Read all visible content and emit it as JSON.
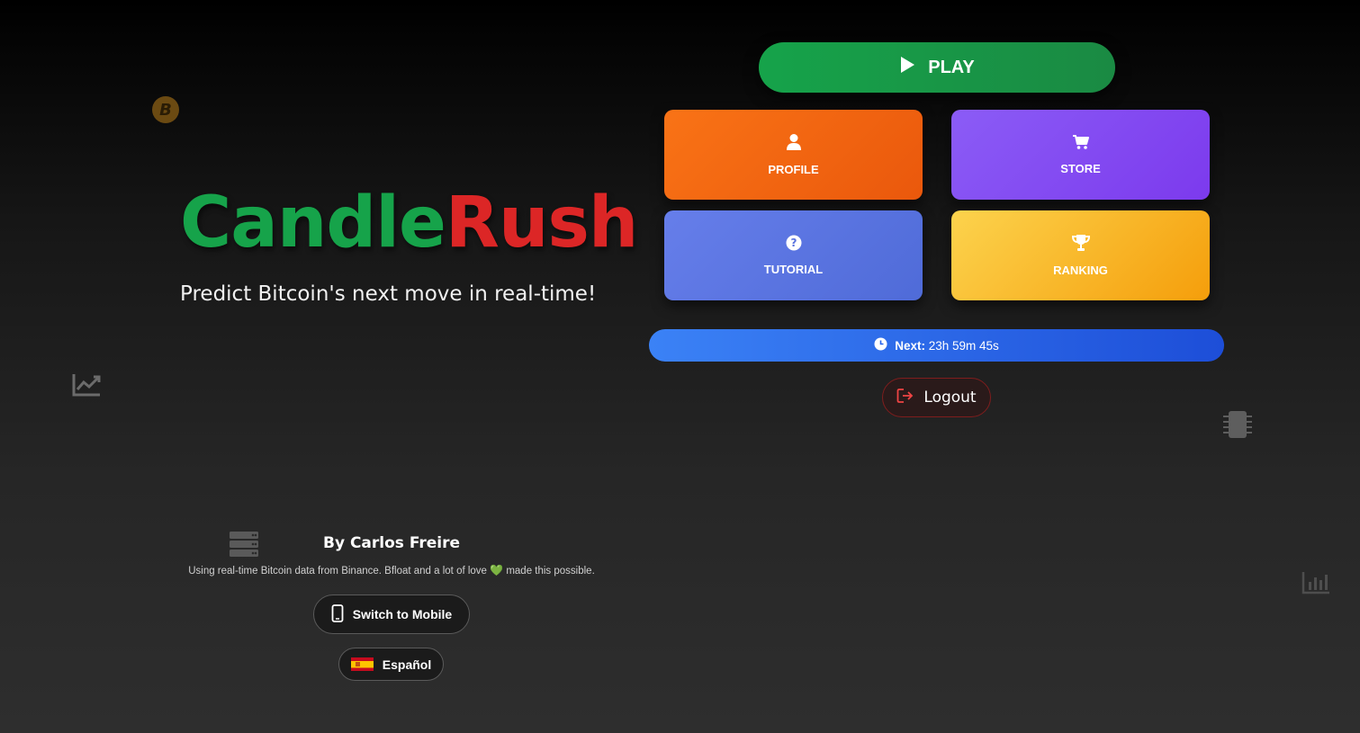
{
  "brand": {
    "title_part1": "Candle",
    "title_part2": "Rush",
    "tagline": "Predict Bitcoin's next move in real-time!"
  },
  "menu": {
    "play_label": "PLAY",
    "tiles": {
      "profile": "PROFILE",
      "store": "STORE",
      "tutorial": "TUTORIAL",
      "ranking": "RANKING"
    }
  },
  "timer": {
    "prefix": "Next:",
    "value": "23h 59m 45s"
  },
  "logout_label": "Logout",
  "credits": {
    "author": "By Carlos Freire",
    "description_before": "Using real-time Bitcoin data from Binance. Bfloat and a lot of love",
    "description_after": "made this possible."
  },
  "footer": {
    "mobile_label": "Switch to Mobile",
    "language_label": "Español"
  },
  "colors": {
    "candle": "#16a34a",
    "rush": "#dc2626",
    "play": "#16a34a",
    "profile": "#f97316",
    "store": "#8b5cf6",
    "tutorial": "#667eea",
    "ranking": "#fbbf24",
    "timer": "#3b82f6"
  },
  "icons": {
    "play": "play-icon",
    "profile": "user-icon",
    "store": "cart-icon",
    "tutorial": "question-circle-icon",
    "ranking": "trophy-icon",
    "timer": "clock-icon",
    "logout": "sign-out-icon",
    "mobile": "mobile-phone-icon",
    "language": "spain-flag-icon"
  }
}
